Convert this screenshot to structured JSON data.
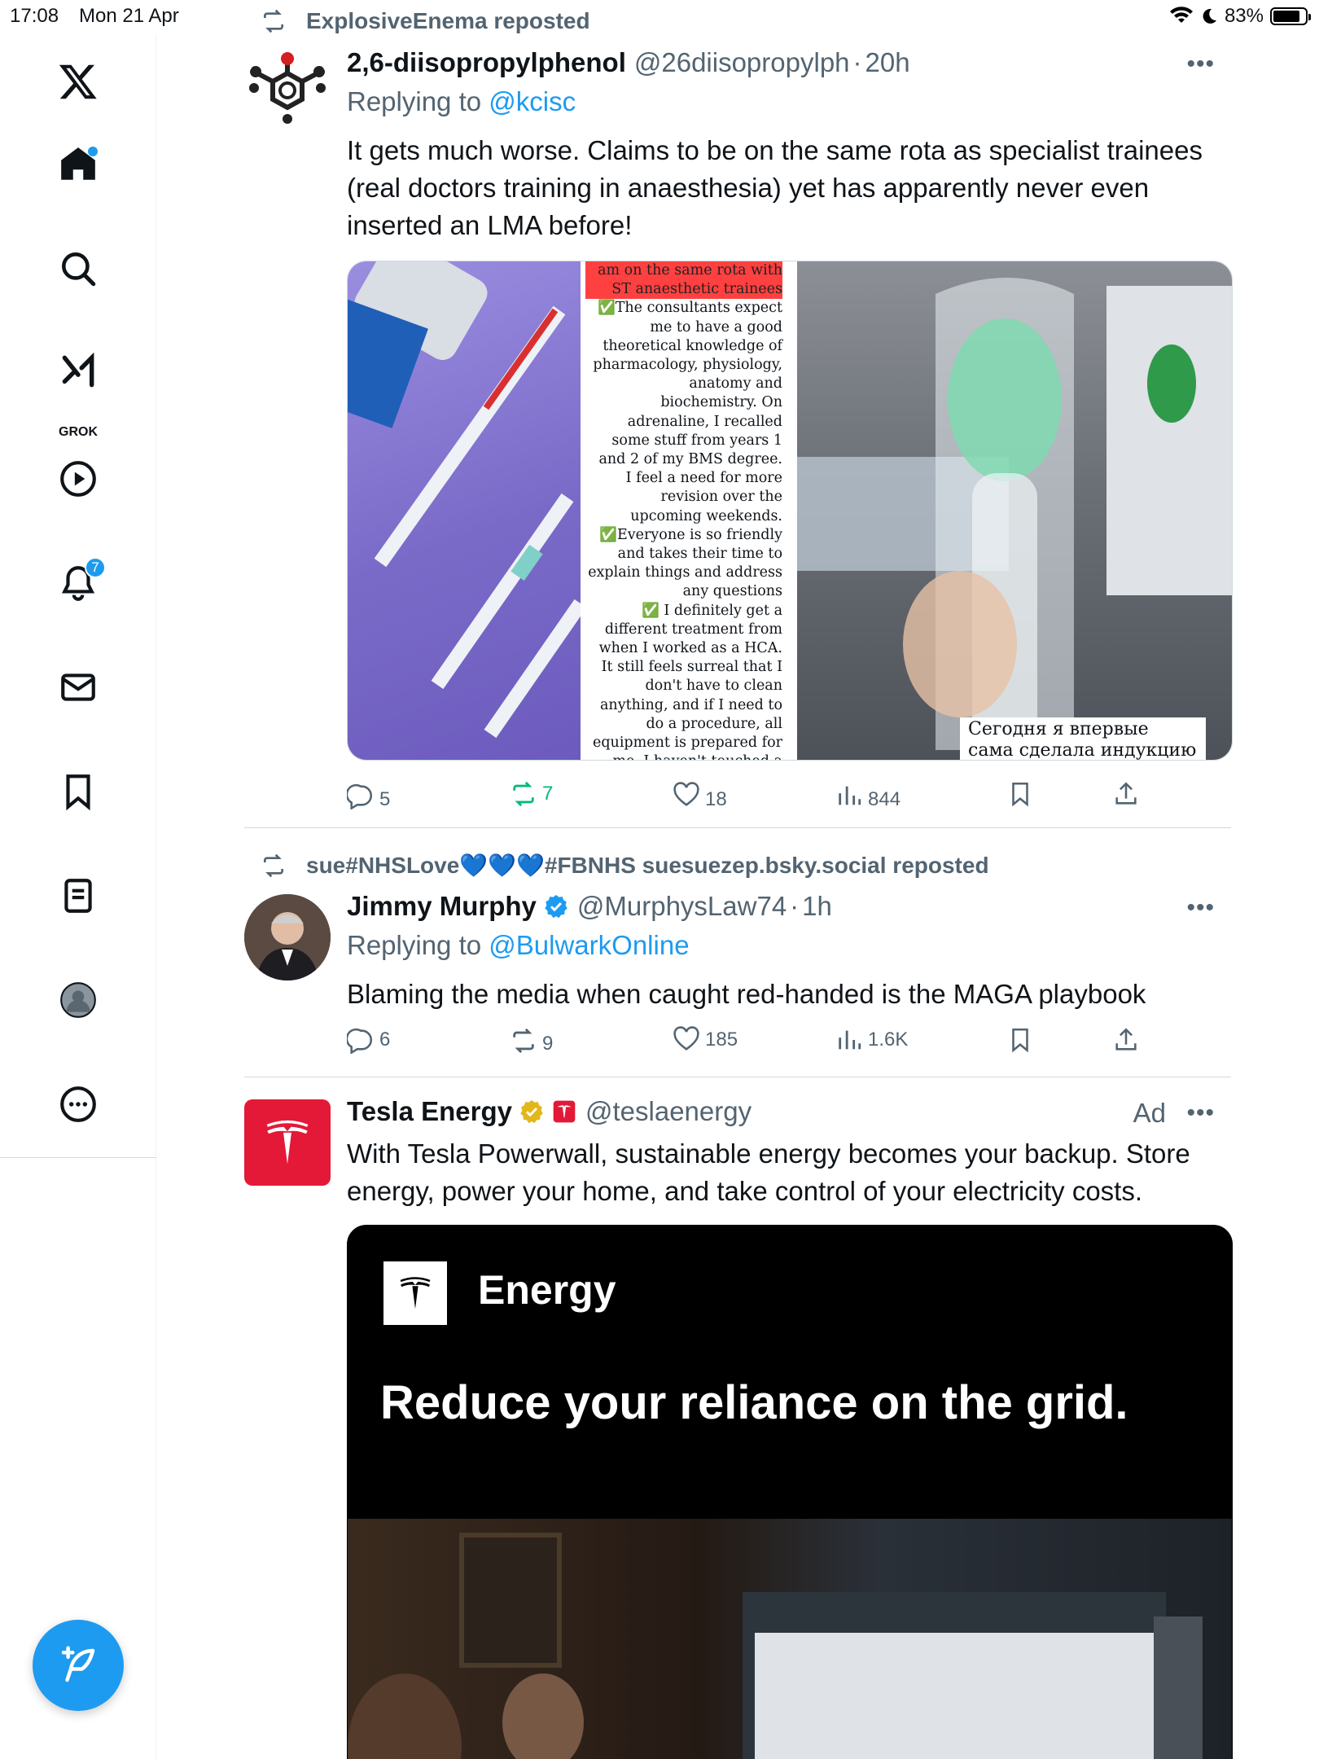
{
  "status_bar": {
    "time": "17:08",
    "date": "Mon 21 Apr",
    "battery": "83%",
    "battery_level": 0.83
  },
  "sidebar": {
    "grok_label": "GROK",
    "notifications_count": "7",
    "items": [
      "x-logo",
      "home",
      "search",
      "grok",
      "video",
      "notifications",
      "messages",
      "bookmarks",
      "lists",
      "profile",
      "more"
    ]
  },
  "tweets": [
    {
      "context": "ExplosiveEnema reposted",
      "name": "2,6-diisopropylphenol",
      "handle": "@26diisopropylph",
      "time": "20h",
      "replying_prefix": "Replying to",
      "replying_to": "@kcisc",
      "text": "It gets much worse. Claims to be on the same rota as specialist trainees (real doctors training in anaesthesia) yet has apparently never even inserted an LMA before!",
      "media_left_lines": [
        "am on the same rota with",
        "ST anaesthetic trainees",
        "✅The consultants expect",
        "me to have a good",
        "theoretical knowledge of",
        "pharmacology, physiology,",
        "anatomy and",
        "biochemistry. On",
        "adrenaline, I recalled",
        "some stuff from years 1",
        "and 2 of my BMS degree.",
        "I feel a need for more",
        "revision over the",
        "upcoming weekends.",
        "✅Everyone is so friendly",
        "and takes their time to",
        "explain things and address",
        "any questions",
        "✅ I definitely get a",
        "different treatment from",
        "when I worked as a HCA.",
        "It still feels surreal that I",
        "don't have to clean",
        "anything, and if I need to",
        "do a procedure, all",
        "equipment is prepared for",
        "me. I haven't touched a"
      ],
      "media_right_caption": "Сегодня я впервые сама сделала индукцию",
      "replies": "5",
      "reposts": "7",
      "likes": "18",
      "views": "844"
    },
    {
      "context": "sue#NHSLove💙💙💙#FBNHS suesuezep.bsky.social reposted",
      "name": "Jimmy Murphy",
      "handle": "@MurphysLaw74",
      "time": "1h",
      "replying_prefix": "Replying to",
      "replying_to": "@BulwarkOnline",
      "text": "Blaming the media when caught red-handed is the MAGA playbook",
      "replies": "6",
      "reposts": "9",
      "likes": "185",
      "views": "1.6K"
    },
    {
      "name": "Tesla Energy",
      "handle": "@teslaenergy",
      "ad_label": "Ad",
      "text": "With Tesla Powerwall, sustainable energy becomes your backup. Store energy, power your home, and take control of your electricity costs.",
      "card_brand": "Energy",
      "card_headline": "Reduce your reliance on the grid."
    }
  ],
  "colors": {
    "accent": "#1d9bf0",
    "repost_green": "#00ba7c",
    "secondary_text": "#536471",
    "tesla_red": "#e31937"
  }
}
